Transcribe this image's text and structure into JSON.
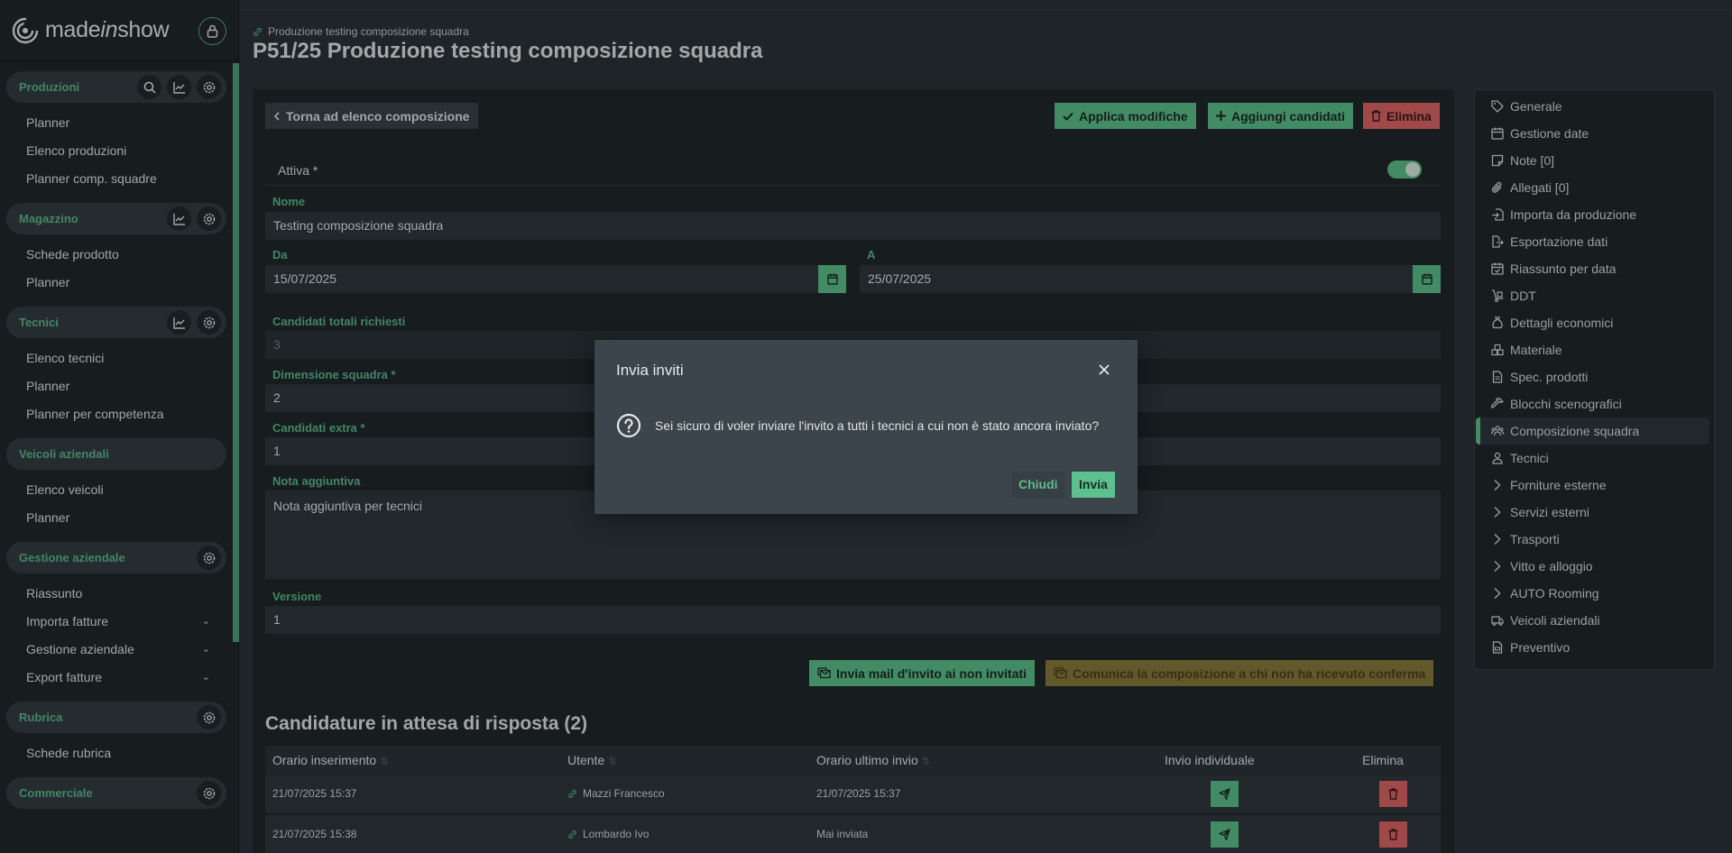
{
  "logo": {
    "prefix": "made",
    "italic": "in",
    "suffix": "show"
  },
  "sidebar": {
    "sections": [
      {
        "title": "Produzioni",
        "items": [
          "Planner",
          "Elenco produzioni",
          "Planner comp. squadre"
        ]
      },
      {
        "title": "Magazzino",
        "items": [
          "Schede prodotto",
          "Planner"
        ]
      },
      {
        "title": "Tecnici",
        "items": [
          "Elenco tecnici",
          "Planner",
          "Planner per competenza"
        ]
      },
      {
        "title": "Veicoli aziendali",
        "items": [
          "Elenco veicoli",
          "Planner"
        ]
      },
      {
        "title": "Gestione aziendale",
        "items": [
          "Riassunto",
          "Importa fatture",
          "Gestione aziendale",
          "Export fatture"
        ]
      },
      {
        "title": "Rubrica",
        "items": [
          "Schede rubrica"
        ]
      },
      {
        "title": "Commerciale",
        "items": []
      }
    ]
  },
  "header": {
    "breadcrumb": "Produzione testing composizione squadra",
    "title": "P51/25 Produzione testing composizione squadra"
  },
  "toolbar": {
    "back": "Torna ad elenco composizione",
    "apply": "Applica modifiche",
    "add": "Aggiungi candidati",
    "delete": "Elimina"
  },
  "form": {
    "attiva_label": "Attiva *",
    "attiva_on": true,
    "nome_label": "Nome",
    "nome_value": "Testing composizione squadra",
    "da_label": "Da",
    "da_value": "15/07/2025",
    "a_label": "A",
    "a_value": "25/07/2025",
    "candidati_totali_label": "Candidati totali richiesti",
    "candidati_totali_value": "3",
    "dimensione_label": "Dimensione squadra *",
    "dimensione_value": "2",
    "extra_label": "Candidati extra *",
    "extra_value": "1",
    "nota_label": "Nota aggiuntiva",
    "nota_value": "Nota aggiuntiva per tecnici",
    "versione_label": "Versione",
    "versione_value": "1"
  },
  "actions": {
    "invite_mail": "Invia mail d'invito ai non invitati",
    "communicate": "Comunica la composizione a chi non ha ricevuto conferma"
  },
  "pending": {
    "title": "Candidature in attesa di risposta (2)",
    "columns": [
      "Orario inserimento",
      "Utente",
      "Orario ultimo invio",
      "Invio individuale",
      "Elimina"
    ],
    "rows": [
      {
        "inserted": "21/07/2025 15:37",
        "user": "Mazzi Francesco",
        "last_sent": "21/07/2025 15:37"
      },
      {
        "inserted": "21/07/2025 15:38",
        "user": "Lombardo Ivo",
        "last_sent": "Mai inviata"
      }
    ]
  },
  "rightnav": {
    "items": [
      {
        "label": "Generale",
        "icon": "tag-icon"
      },
      {
        "label": "Gestione date",
        "icon": "calendar-icon"
      },
      {
        "label": "Note [0]",
        "icon": "note-icon"
      },
      {
        "label": "Allegati [0]",
        "icon": "paperclip-icon"
      },
      {
        "label": "Importa da produzione",
        "icon": "file-import-icon"
      },
      {
        "label": "Esportazione dati",
        "icon": "file-export-icon"
      },
      {
        "label": "Riassunto per data",
        "icon": "calendar-check-icon"
      },
      {
        "label": "DDT",
        "icon": "dolly-icon"
      },
      {
        "label": "Dettagli economici",
        "icon": "money-bag-icon"
      },
      {
        "label": "Materiale",
        "icon": "boxes-icon"
      },
      {
        "label": "Spec. prodotti",
        "icon": "file-icon"
      },
      {
        "label": "Blocchi scenografici",
        "icon": "hammer-icon"
      },
      {
        "label": "Composizione squadra",
        "icon": "users-icon",
        "active": true
      },
      {
        "label": "Tecnici",
        "icon": "user-icon"
      },
      {
        "label": "Forniture esterne",
        "icon": "chevron-right-icon"
      },
      {
        "label": "Servizi esterni",
        "icon": "chevron-right-icon"
      },
      {
        "label": "Trasporti",
        "icon": "chevron-right-icon"
      },
      {
        "label": "Vitto e alloggio",
        "icon": "chevron-right-icon"
      },
      {
        "label": "AUTO Rooming",
        "icon": "chevron-right-icon"
      },
      {
        "label": "Veicoli aziendali",
        "icon": "truck-icon"
      },
      {
        "label": "Preventivo",
        "icon": "file-invoice-icon"
      }
    ]
  },
  "modal": {
    "title": "Invia inviti",
    "message": "Sei sicuro di voler inviare l'invito a tutti i tecnici a cui non è stato ancora inviato?",
    "close_label": "Chiudi",
    "confirm_label": "Invia"
  },
  "colors": {
    "accent": "#5cc18d",
    "danger": "#e06464",
    "warning": "#8a7a3a",
    "background": "#2a3237",
    "panel": "#20272b"
  }
}
